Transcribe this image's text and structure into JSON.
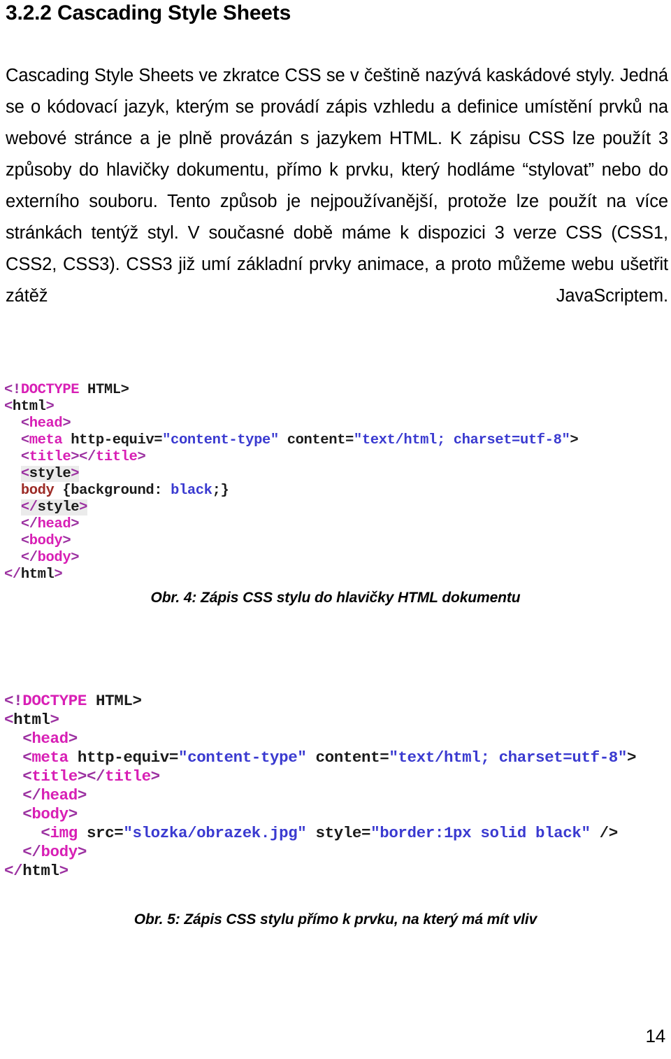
{
  "document": {
    "heading": {
      "number": "3.2.2",
      "title": "Cascading Style Sheets"
    },
    "paragraph": "Cascading Style Sheets ve zkratce CSS se v češtině nazývá kaskádové styly. Jedná se o kódovací jazyk, kterým se provádí zápis vzhledu a definice umístění prvků na webové stránce a je plně provázán s jazykem HTML. K zápisu CSS lze použít 3 způsoby do hlavičky dokumentu, přímo k prvku, který hodláme “stylovat” nebo do externího souboru. Tento způsob je nejpoužívanější, protože lze použít na více stránkách tentýž styl. V současné době máme k dispozici 3 verze CSS (CSS1, CSS2, CSS3). CSS3 již umí základní prvky animace, a proto můžeme webu ušetřit zátěž JavaScriptem.",
    "page_number": "14"
  },
  "figure_4": {
    "caption": "Obr. 4: Zápis CSS stylu do hlavičky HTML dokumentu",
    "code_lines": [
      "<!DOCTYPE HTML>",
      "<html>",
      "  <head>",
      "  <meta http-equiv=\"content-type\" content=\"text/html; charset=utf-8\">",
      "  <title></title>",
      "  <style>",
      "  body {background: black;}",
      "  </style>",
      "  </head>",
      "  <body>",
      "  </body>",
      "</html>"
    ]
  },
  "figure_5": {
    "caption": "Obr. 5: Zápis CSS stylu přímo k prvku, na který má mít vliv",
    "code_lines": [
      "<!DOCTYPE HTML>",
      "<html>",
      "  <head>",
      "  <meta http-equiv=\"content-type\" content=\"text/html; charset=utf-8\">",
      "  <title></title>",
      "  </head>",
      "  <body>",
      "    <img src=\"slozka/obrazek.jpg\" style=\"border:1px solid black\" />",
      "  </body>",
      "</html>"
    ]
  },
  "colors": {
    "bracket": "#9b30a0",
    "tag_name": "#d81fb5",
    "attribute_value": "#3a3ad0",
    "css_selector": "#9c2b26",
    "css_value": "#3a3ad0",
    "highlight_background": "#ebebeb",
    "text": "#000000",
    "page_background": "#ffffff"
  }
}
